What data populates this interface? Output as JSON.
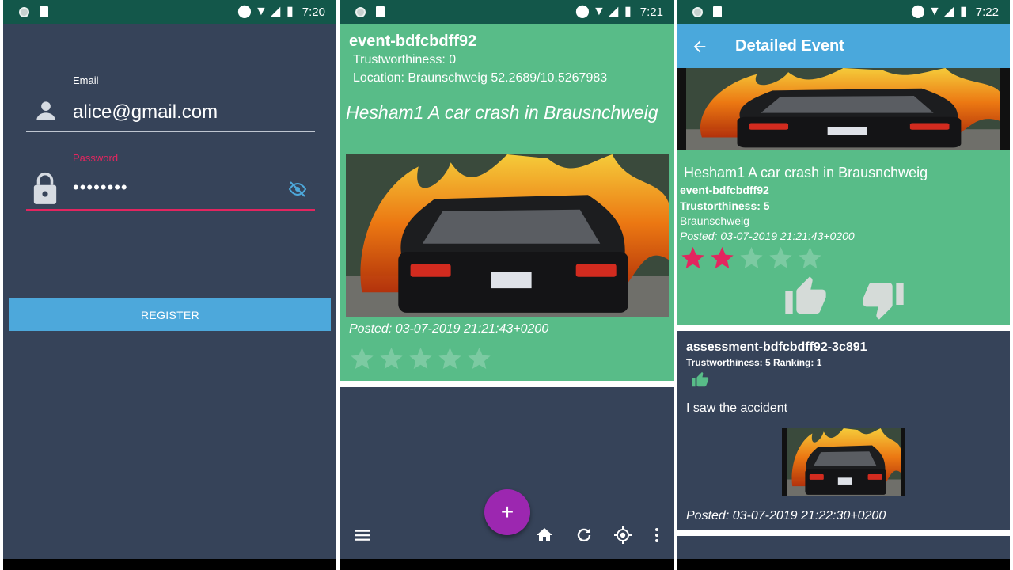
{
  "screen1": {
    "status_time": "7:20",
    "email_label": "Email",
    "email_value": "alice@gmail.com",
    "password_label": "Password",
    "password_value": "••••••••",
    "register_label": "REGISTER"
  },
  "screen2": {
    "status_time": "7:21",
    "event_id": "event-bdfcbdff92",
    "trustworthiness": "Trustworthiness: 0",
    "location": "Location: Braunschweig 52.2689/10.5267983",
    "title": "Hesham1 A car crash in Brausnchweig",
    "posted": "Posted: 03-07-2019 21:21:43+0200",
    "rating": 0,
    "fab_label": "+"
  },
  "screen3": {
    "status_time": "7:22",
    "appbar_title": "Detailed Event",
    "title": "Hesham1 A car crash in Brausnchweig",
    "event_id": "event-bdfcbdff92",
    "trustworthiness": "Trustorthiness: 5",
    "city": "Braunschweig",
    "posted": "Posted: 03-07-2019 21:21:43+0200",
    "rating": 2,
    "assessment": {
      "id": "assessment-bdfcbdff92-3c891",
      "trust_ranking": "Trustworthiness: 5 Ranking: 1",
      "text": "I saw the accident",
      "posted": "Posted: 03-07-2019 21:22:30+0200"
    }
  },
  "colors": {
    "background": "#364359",
    "status_bar": "#13574a",
    "card_green": "#58bc88",
    "accent_blue": "#4da8db",
    "accent_pink": "#e3255f",
    "fab_purple": "#9c27b0"
  },
  "icons": [
    "person-icon",
    "lock-icon",
    "eye-off-icon",
    "star-icon",
    "plus-icon",
    "menu-icon",
    "home-icon",
    "refresh-icon",
    "gps-icon",
    "more-vert-icon",
    "back-arrow-icon",
    "thumb-up-icon",
    "thumb-down-icon"
  ]
}
